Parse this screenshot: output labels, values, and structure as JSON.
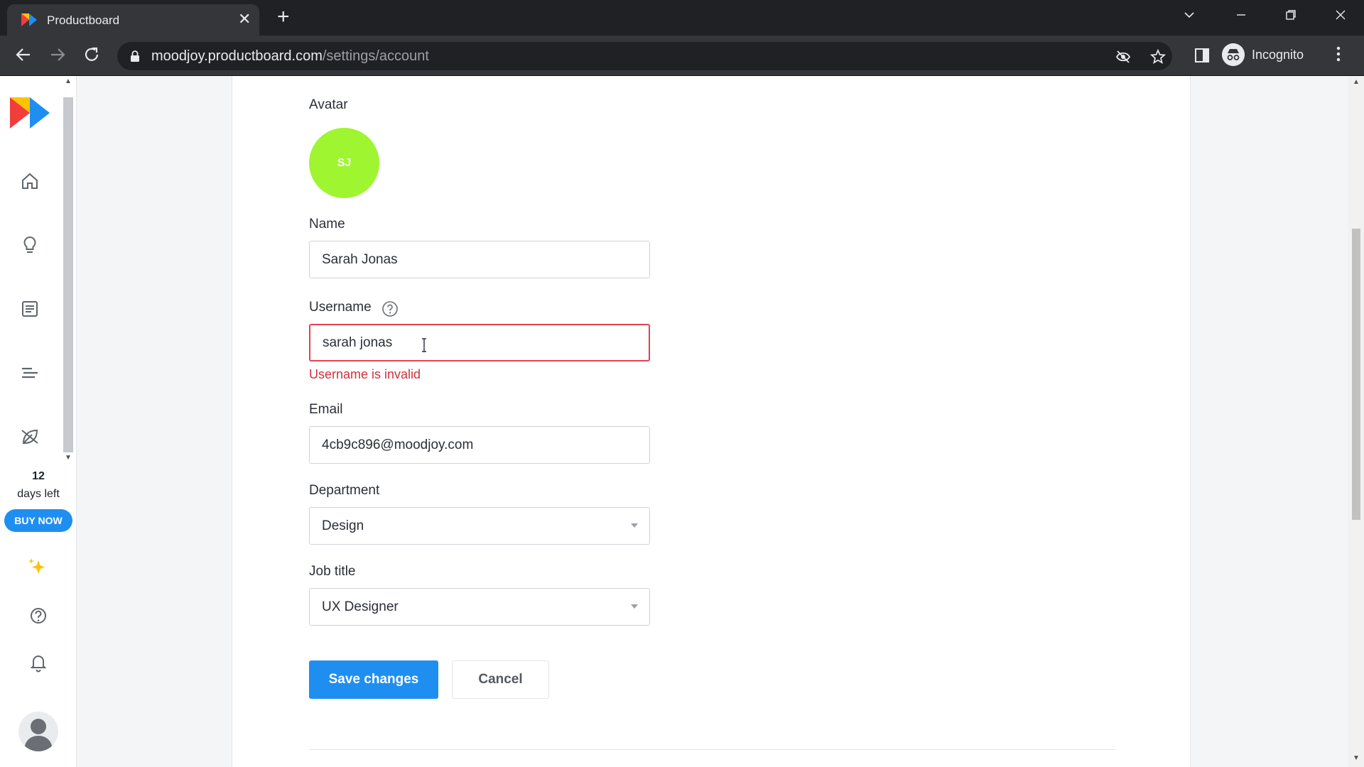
{
  "browser": {
    "tab_title": "Productboard",
    "tab_close": "✕",
    "new_tab": "+",
    "url_host": "moodjoy.productboard.com",
    "url_path": "/settings/account",
    "incognito_label": "Incognito"
  },
  "sidebar": {
    "trial_days": "12",
    "trial_label": "days left",
    "buy_now": "BUY NOW"
  },
  "form": {
    "avatar_label": "Avatar",
    "avatar_initials": "SJ",
    "avatar_color": "#9ff530",
    "name_label": "Name",
    "name_value": "Sarah Jonas",
    "username_label": "Username",
    "username_value": "sarah jonas",
    "username_error": "Username is invalid",
    "email_label": "Email",
    "email_value": "4cb9c896@moodjoy.com",
    "department_label": "Department",
    "department_value": "Design",
    "job_title_label": "Job title",
    "job_title_value": "UX Designer",
    "save_label": "Save changes",
    "cancel_label": "Cancel"
  },
  "colors": {
    "primary": "#1f8ef1",
    "error": "#d0303d"
  }
}
